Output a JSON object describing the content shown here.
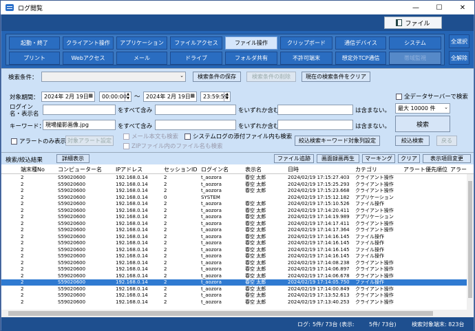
{
  "window": {
    "title": "ログ閲覧",
    "minimize": "—",
    "maximize": "☐",
    "close": "✕"
  },
  "header": {
    "file_menu": "ファイル"
  },
  "categories": {
    "row1": [
      "起動・終了",
      "クライアント操作",
      "アプリケーション",
      "ファイルアクセス",
      "ファイル操作",
      "クリップボード",
      "通信デバイス",
      "システム"
    ],
    "row2": [
      "プリント",
      "Webアクセス",
      "メール",
      "ドライブ",
      "フォルダ共有",
      "不許可端末",
      "想定外TCP通信",
      "帯域監視"
    ],
    "select_all": "全選択",
    "deselect_all": "全解除"
  },
  "filter": {
    "search_condition_label": "検索条件：",
    "search_condition_value": "",
    "save_condition": "検索条件の保存",
    "delete_condition": "検索条件の削除",
    "clear_condition": "現在の検索条件をクリア",
    "period_label": "対象期間：",
    "date_from": "2024年 2月 19日",
    "time_from": "00:00:00",
    "tilde": "〜",
    "date_to": "2024年 2月 19日",
    "time_to": "23:59:59",
    "all_servers_label": "全データサーバーで検索",
    "login_label": "ログイン名・表示名",
    "contains_all": "をすべて含み",
    "contains_any": "をいずれか含む。",
    "not_contains": "は含まない。",
    "keyword_label": "キーワード：",
    "keyword_value": "現場撮影画像.jpg",
    "max_label": "最大 10000 件",
    "search_button": "検索",
    "alert_only_label": "アラートのみ表示:",
    "target_alert_settings": "対象アラート設定",
    "mail_body_label": "メール本文も検索",
    "syslog_attach_label": "システムログの添付ファイル内も検索",
    "zip_label": "ZIPファイル内のファイル名も検索",
    "narrow_keyword_settings": "絞込検索キーワード対象列設定",
    "narrow_search": "絞込検索",
    "back": "戻る"
  },
  "results": {
    "title": "検索/絞込結果",
    "detail": "詳細表示",
    "file_trace": "ファイル追跡",
    "screen_replay": "画面録画再生",
    "marking": "マーキング",
    "clear": "クリア",
    "change_columns": "表示項目変更"
  },
  "table": {
    "columns": [
      "端末種No",
      "コンピューター名",
      "IPアドレス",
      "セッションID",
      "ログイン名",
      "表示名",
      "日時",
      "カテゴリ",
      "アラート優先順位",
      "アラー"
    ],
    "rows": [
      [
        "2",
        "S59020600",
        "192.168.0.14",
        "2",
        "t_aozora",
        "春空 太郎",
        "2024/02/19 17:15:27.403",
        "クライアント操作"
      ],
      [
        "2",
        "S59020600",
        "192.168.0.14",
        "2",
        "t_aozora",
        "春空 太郎",
        "2024/02/19 17:15:25.293",
        "クライアント操作"
      ],
      [
        "2",
        "S59020600",
        "192.168.0.14",
        "2",
        "t_aozora",
        "春空 太郎",
        "2024/02/19 17:15:23.668",
        "クライアント操作"
      ],
      [
        "2",
        "S59020600",
        "192.168.0.14",
        "0",
        "SYSTEM",
        "",
        "2024/02/19 17:15:12.182",
        "アプリケーション"
      ],
      [
        "2",
        "S59020600",
        "192.168.0.14",
        "2",
        "t_aozora",
        "春空 太郎",
        "2024/02/19 17:15:10.526",
        "ファイル操作"
      ],
      [
        "2",
        "S59020600",
        "192.168.0.14",
        "2",
        "t_aozora",
        "春空 太郎",
        "2024/02/19 17:14:20.411",
        "クライアント操作"
      ],
      [
        "2",
        "S59020600",
        "192.168.0.14",
        "2",
        "t_aozora",
        "春空 太郎",
        "2024/02/19 17:14:19.989",
        "アプリケーション"
      ],
      [
        "2",
        "S59020600",
        "192.168.0.14",
        "2",
        "t_aozora",
        "春空 太郎",
        "2024/02/19 17:14:17.411",
        "クライアント操作"
      ],
      [
        "2",
        "S59020600",
        "192.168.0.14",
        "2",
        "t_aozora",
        "春空 太郎",
        "2024/02/19 17:14:17.364",
        "クライアント操作"
      ],
      [
        "2",
        "S59020600",
        "192.168.0.14",
        "2",
        "t_aozora",
        "春空 太郎",
        "2024/02/19 17:14:16.145",
        "ファイル操作"
      ],
      [
        "2",
        "S59020600",
        "192.168.0.14",
        "2",
        "t_aozora",
        "春空 太郎",
        "2024/02/19 17:14:16.145",
        "ファイル操作"
      ],
      [
        "2",
        "S59020600",
        "192.168.0.14",
        "2",
        "t_aozora",
        "春空 太郎",
        "2024/02/19 17:14:16.145",
        "ファイル操作"
      ],
      [
        "2",
        "S59020600",
        "192.168.0.14",
        "2",
        "t_aozora",
        "春空 太郎",
        "2024/02/19 17:14:16.145",
        "ファイル操作"
      ],
      [
        "2",
        "S59020600",
        "192.168.0.14",
        "2",
        "t_aozora",
        "春空 太郎",
        "2024/02/19 17:14:08.238",
        "クライアント操作"
      ],
      [
        "2",
        "S59020600",
        "192.168.0.14",
        "2",
        "t_aozora",
        "春空 太郎",
        "2024/02/19 17:14:06.897",
        "クライアント操作"
      ],
      [
        "2",
        "S59020600",
        "192.168.0.14",
        "2",
        "t_aozora",
        "春空 太郎",
        "2024/02/19 17:14:06.678",
        "クライアント操作"
      ],
      [
        "2",
        "S59020600",
        "192.168.0.14",
        "2",
        "t_aozora",
        "春空 太郎",
        "2024/02/19 17:14:05.750",
        "ファイル操作"
      ],
      [
        "2",
        "S59020600",
        "192.168.0.14",
        "2",
        "t_aozora",
        "春空 太郎",
        "2024/02/19 17:14:00.849",
        "クライアント操作"
      ],
      [
        "2",
        "S59020600",
        "192.168.0.14",
        "2",
        "t_aozora",
        "春空 太郎",
        "2024/02/19 17:13:52.613",
        "クライアント操作"
      ],
      [
        "2",
        "S59020600",
        "192.168.0.14",
        "2",
        "t_aozora",
        "春空 太郎",
        "2024/02/19 17:13:40.253",
        "クライアント操作"
      ]
    ],
    "selected_row": 16
  },
  "status": {
    "log_label": "ログ:",
    "log_value": "5件/ 73台 (表示:",
    "log_value2": "5件/ 73台)",
    "target_label": "検索対象端末: 823台"
  }
}
